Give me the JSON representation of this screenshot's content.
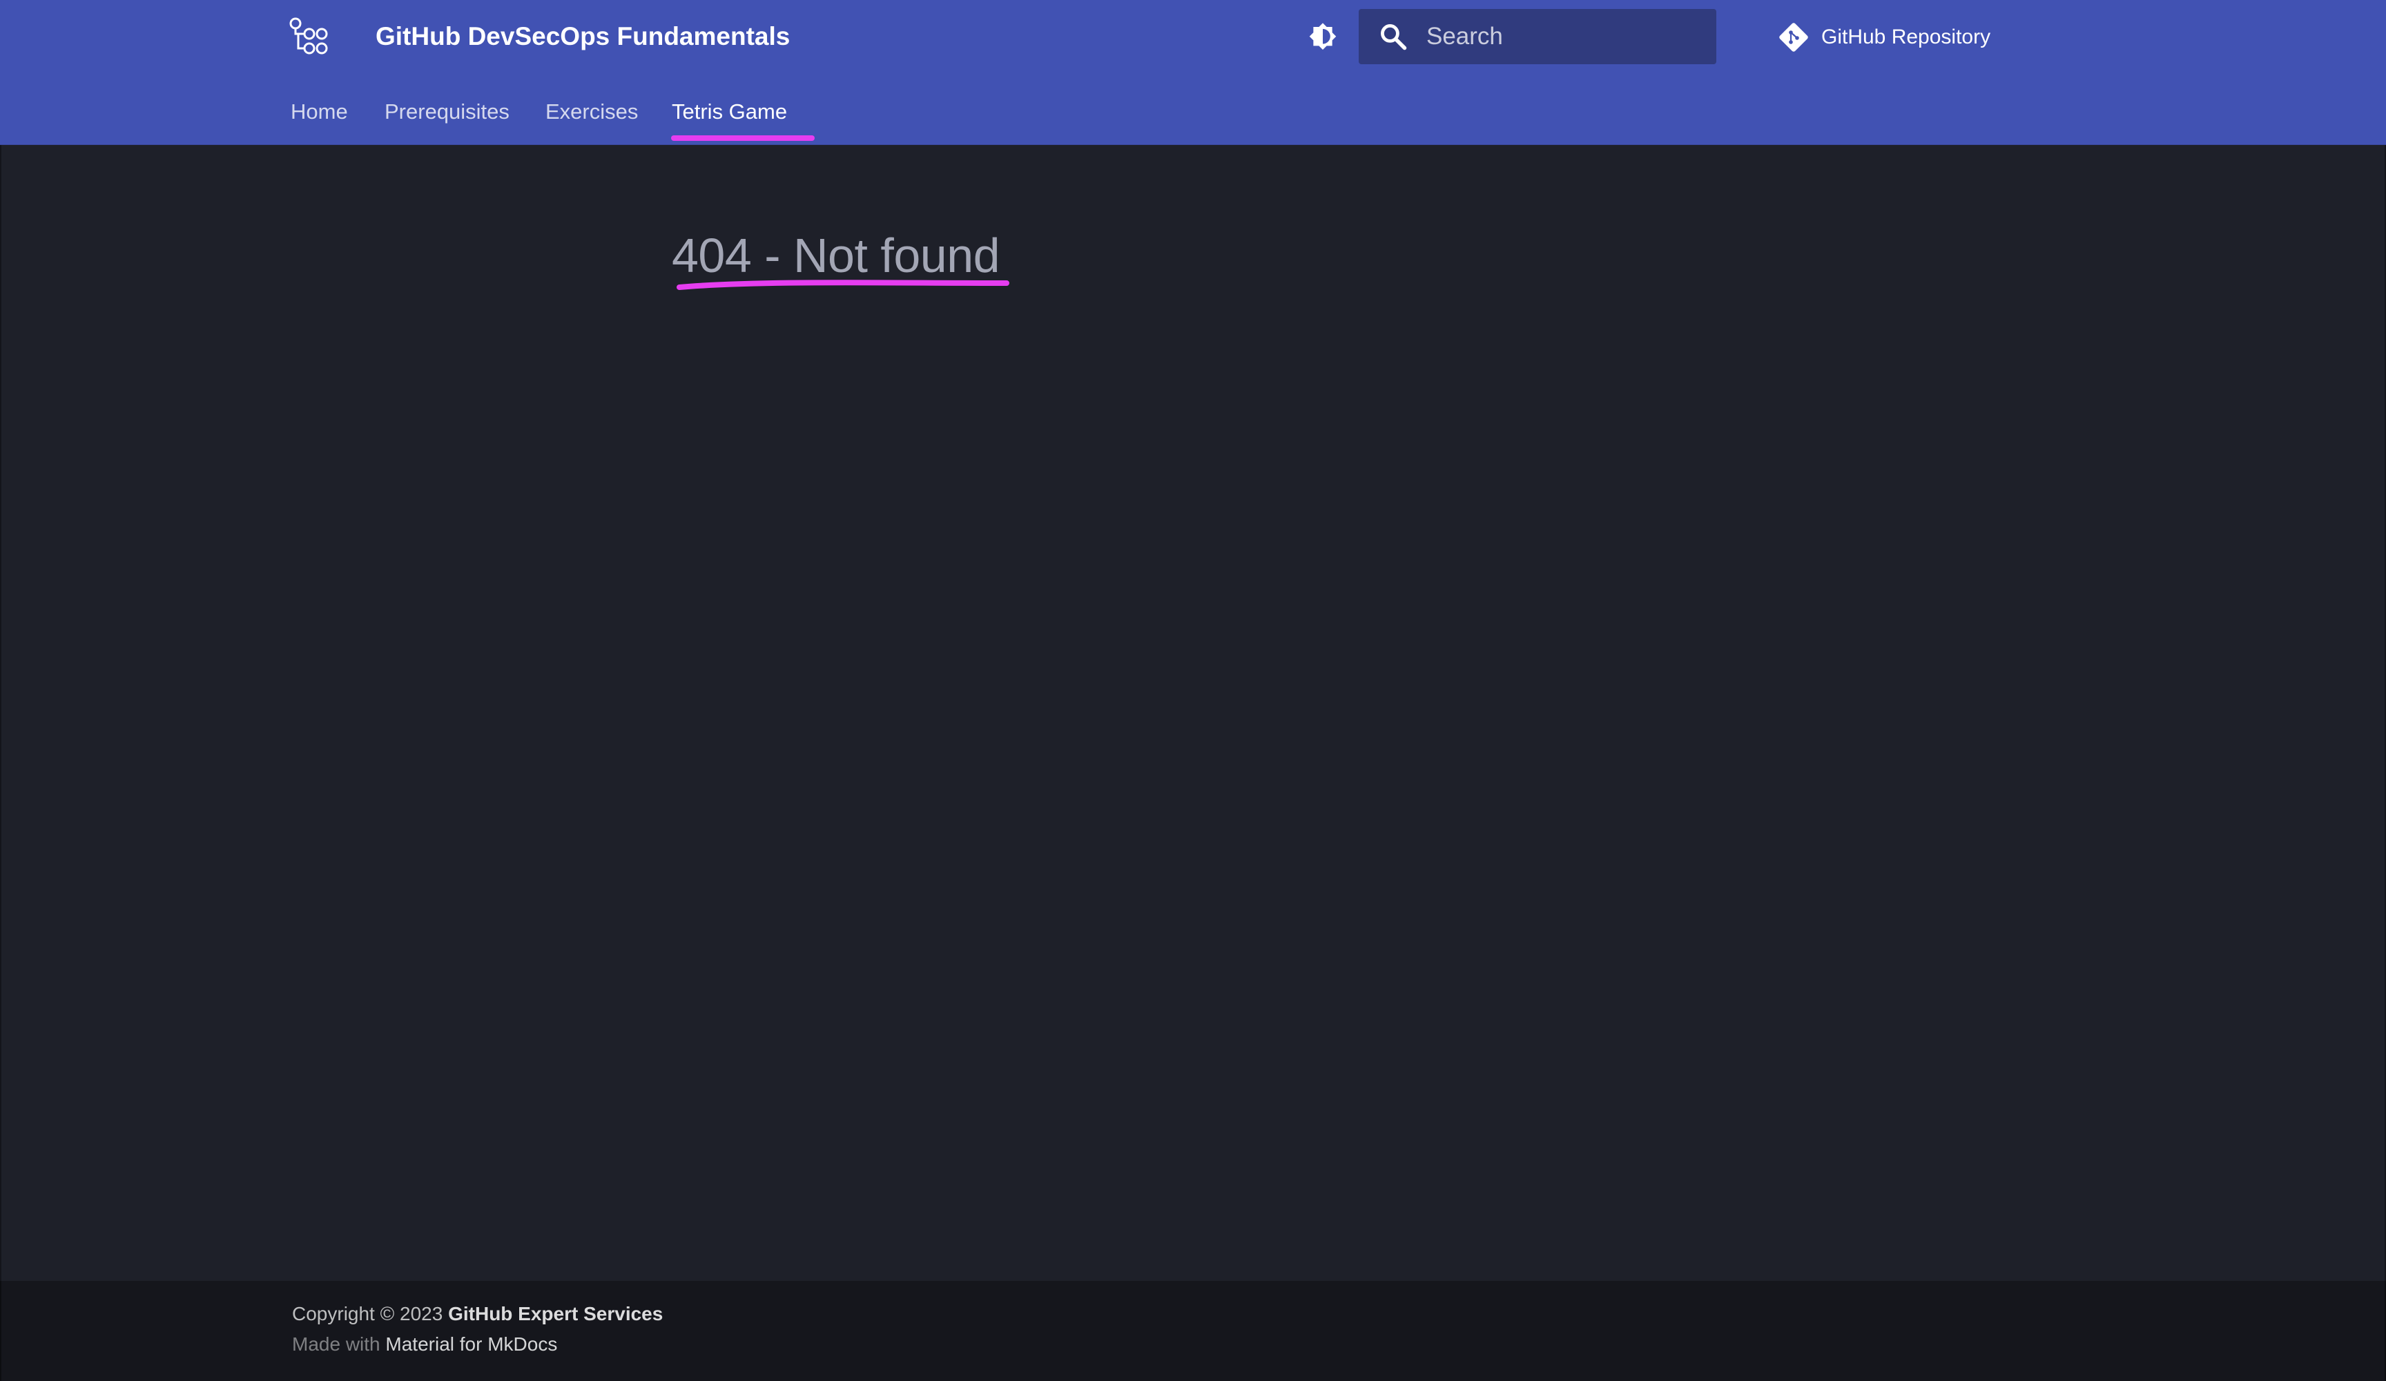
{
  "header": {
    "title": "GitHub DevSecOps Fundamentals",
    "logo_icon": "workflow-icon",
    "theme_toggle_icon": "brightness-icon",
    "search": {
      "placeholder": "Search",
      "value": "",
      "icon": "search-icon"
    },
    "repo": {
      "label": "GitHub Repository",
      "icon": "git-icon"
    },
    "background_color": "#4152b3"
  },
  "tabs": [
    {
      "label": "Home",
      "active": false
    },
    {
      "label": "Prerequisites",
      "active": false
    },
    {
      "label": "Exercises",
      "active": false
    },
    {
      "label": "Tetris Game",
      "active": true
    }
  ],
  "accent_color": "#e63df0",
  "main": {
    "title": "404 - Not found"
  },
  "footer": {
    "copyright_prefix": "Copyright © 2023",
    "copyright_owner": "GitHub Expert Services",
    "made_with_prefix": "Made with",
    "made_with_link": "Material for MkDocs"
  }
}
